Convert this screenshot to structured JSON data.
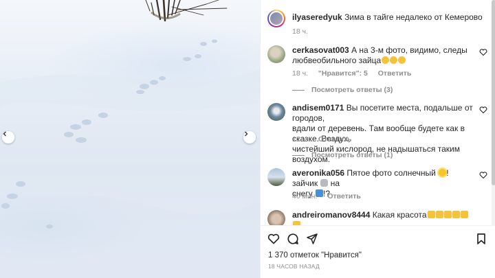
{
  "post": {
    "author": "ilyaseredyuk",
    "caption": "Зима в тайге недалеко от Кемерово",
    "time": "18 ч."
  },
  "comments": [
    {
      "username": "cerkasovat003",
      "text_line1": "А на 3-м фото, видимо, следы",
      "text_line2": "любвеобильного зайца",
      "time": "18 ч.",
      "likes": "\"Нравится\": 5",
      "reply": "Ответить",
      "replies": "Посмотреть ответы (3)"
    },
    {
      "username": "andisem0171",
      "text_line1": "Вы посетите места, подальше от городов,",
      "text_line2": "вдали от деревень. Там вообще будете как в сказке. Воздух,",
      "text_line3": "чистейший кислород, не надышаться таким воздухом.",
      "time": "12 ч.",
      "reply": "Ответить",
      "replies": "Посмотреть ответы (1)"
    },
    {
      "username": "averonika056",
      "text_part1": "Пятое фото солнечный",
      "text_part2": "! зайчик",
      "text_part3": "на",
      "text_line2": "снегу",
      "text_end": "!?",
      "time": "40 мин.",
      "reply": "Ответить"
    },
    {
      "username": "andreiromanov8444",
      "text": "Какая красота"
    }
  ],
  "footer": {
    "likes_count": "1 370 отметок \"Нравится\"",
    "date": "18 ЧАСОВ НАЗАД"
  },
  "icons": {
    "like": "heart-icon",
    "comment": "comment-icon",
    "share": "paper-plane-icon",
    "save": "bookmark-icon",
    "prev": "chevron-left-icon",
    "next": "chevron-right-icon"
  }
}
